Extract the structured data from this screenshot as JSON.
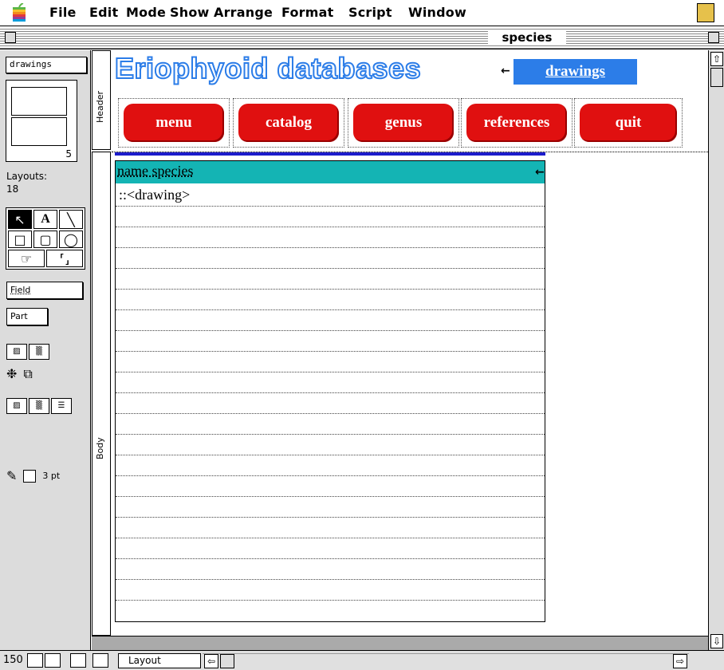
{
  "menubar": {
    "items": [
      "File",
      "Edit",
      "Mode",
      "Show",
      "Arrange",
      "Format",
      "Script",
      "Window"
    ]
  },
  "window": {
    "title": "species"
  },
  "tools": {
    "layout_popup": "drawings",
    "layout_number": "5",
    "layouts_label": "Layouts:",
    "layouts_count": "18",
    "field_button": "Field",
    "part_button": "Part",
    "line_width": "3 pt"
  },
  "parts": {
    "header": "Header",
    "body": "Body"
  },
  "layout": {
    "db_title": "Eriophyoid databases",
    "drawings_tag": "drawings",
    "buttons": [
      "menu",
      "catalog",
      "genus",
      "references",
      "quit"
    ],
    "species_field": "name species",
    "drawing_field": "::<drawing>"
  },
  "status": {
    "zoom": "150",
    "mode": "Layout"
  },
  "colors": {
    "title_outline": "#2c7de8",
    "button_red": "#e01010",
    "field_teal": "#14b4b4",
    "tag_blue": "#2c7de8"
  }
}
